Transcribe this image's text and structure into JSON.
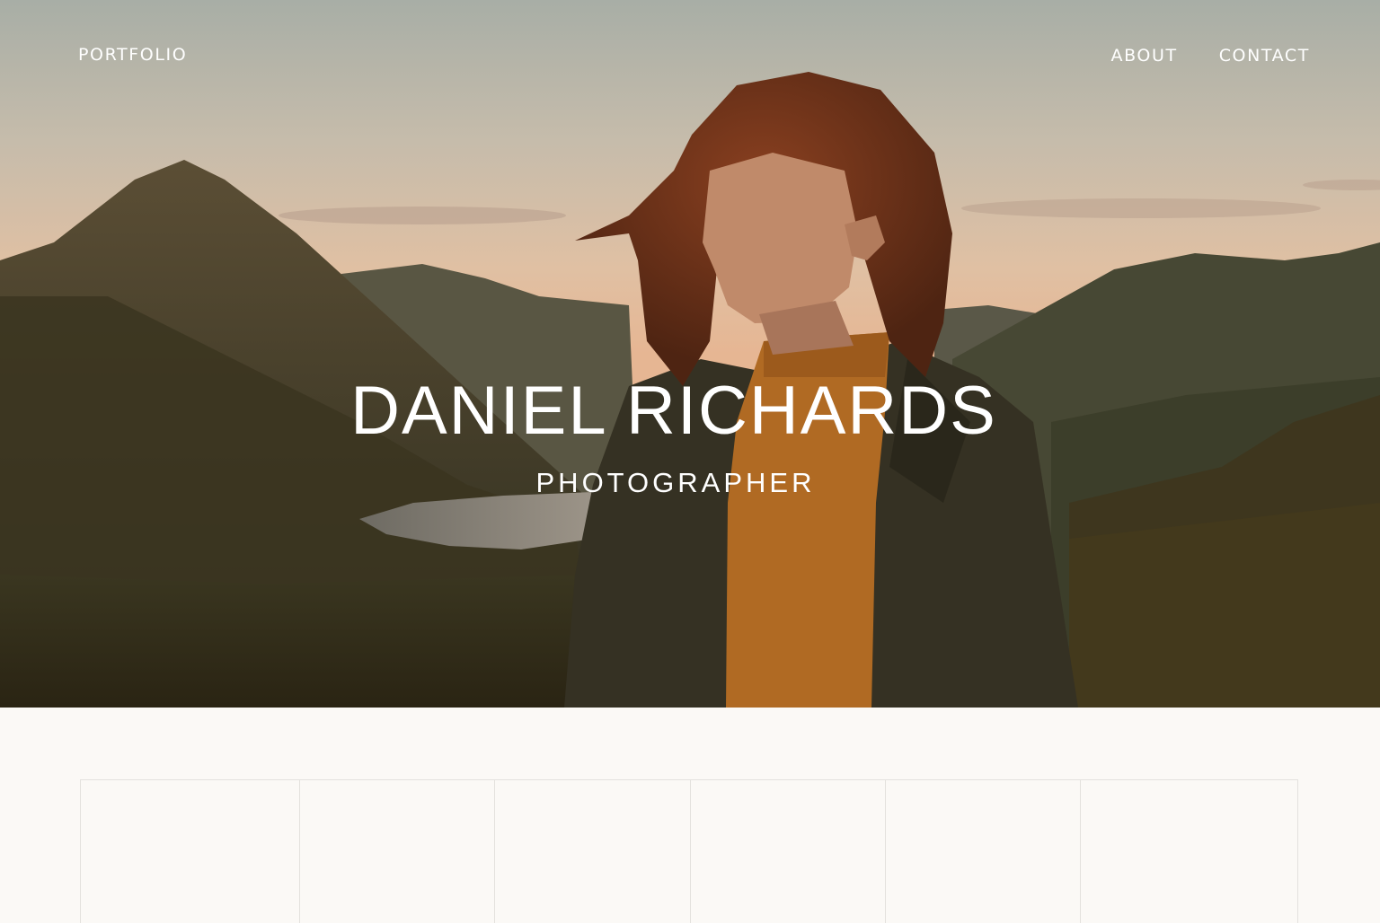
{
  "nav": {
    "logo": "PORTFOLIO",
    "links": [
      "ABOUT",
      "CONTACT"
    ]
  },
  "hero": {
    "title": "DANIEL RICHARDS",
    "subtitle": "PHOTOGRAPHER",
    "image": "portrait of a red-haired woman in a dark coat against mountains at sunset"
  },
  "gallery": {
    "cells": 6
  },
  "colors": {
    "background": "#fbf9f6",
    "grid_line": "#e4e2de",
    "nav_text": "#ffffff"
  }
}
